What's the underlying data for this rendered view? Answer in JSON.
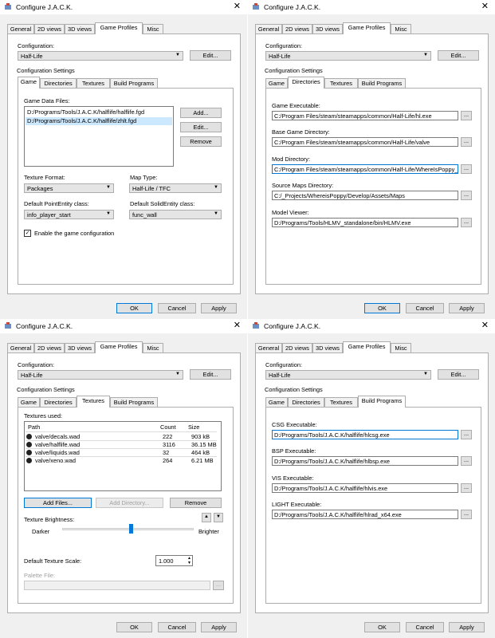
{
  "dialog_title": "Configure J.A.C.K.",
  "close_glyph": "✕",
  "tabs": [
    "General",
    "2D views",
    "3D views",
    "Game Profiles",
    "Misc"
  ],
  "config": {
    "label": "Configuration:",
    "value": "Half-Life",
    "edit": "Edit..."
  },
  "settings_label": "Configuration Settings",
  "subtabs": [
    "Game",
    "Directories",
    "Textures",
    "Build Programs"
  ],
  "footer": {
    "ok": "OK",
    "cancel": "Cancel",
    "apply": "Apply"
  },
  "browse": "...",
  "game": {
    "fgd_label": "Game Data Files:",
    "fgd": [
      "D:/Programs/Tools/J.A.C.K/halflife/halflife.fgd",
      "D:/Programs/Tools/J.A.C.K/halflife/zhlt.fgd"
    ],
    "add": "Add...",
    "edit": "Edit...",
    "remove": "Remove",
    "tex_format_label": "Texture Format:",
    "tex_format": "Packages",
    "map_type_label": "Map Type:",
    "map_type": "Half-Life / TFC",
    "point_label": "Default PointEntity class:",
    "point": "info_player_start",
    "solid_label": "Default SolidEntity class:",
    "solid": "func_wall",
    "enable_label": "Enable the game configuration",
    "check": "✓"
  },
  "dirs": {
    "exe_label": "Game Executable:",
    "exe": "C:/Program Files/steam/steamapps/common/Half-Life/hl.exe",
    "base_label": "Base Game Directory:",
    "base": "C:/Program Files/steam/steamapps/common/Half-Life/valve",
    "mod_label": "Mod Directory:",
    "mod": "C:/Program Files/steam/steamapps/common/Half-Life/WhereIsPoppy_de",
    "src_label": "Source Maps Directory:",
    "src": "C:/_Projects/WhereisPoppy/Develop/Assets/Maps",
    "viewer_label": "Model Viewer:",
    "viewer": "D:/Programs/Tools/HLMV_standalone/bin/HLMV.exe"
  },
  "textures": {
    "used_label": "Textures used:",
    "headers": [
      "Path",
      "Count",
      "Size"
    ],
    "rows": [
      {
        "path": "valve/decals.wad",
        "count": "222",
        "size": "903 kB"
      },
      {
        "path": "valve/halflife.wad",
        "count": "3116",
        "size": "36.15 MB"
      },
      {
        "path": "valve/liquids.wad",
        "count": "32",
        "size": "464 kB"
      },
      {
        "path": "valve/xeno.wad",
        "count": "264",
        "size": "6.21 MB"
      }
    ],
    "add_files": "Add Files...",
    "add_dir": "Add Directory...",
    "remove": "Remove",
    "brightness_label": "Texture Brightness:",
    "darker": "Darker",
    "brighter": "Brighter",
    "brightness_level": 0.52,
    "scale_label": "Default Texture Scale:",
    "scale": "1.000",
    "palette_label": "Palette File:",
    "up": "▲",
    "down": "▼"
  },
  "build": {
    "csg_label": "CSG Executable:",
    "csg": "D:/Programs/Tools/J.A.C.K/halflife/hlcsg.exe",
    "bsp_label": "BSP Executable:",
    "bsp": "D:/Programs/Tools/J.A.C.K/halflife/hlbsp.exe",
    "vis_label": "VIS Executable:",
    "vis": "D:/Programs/Tools/J.A.C.K/halflife/hlvis.exe",
    "light_label": "LIGHT Executable:",
    "light": "D:/Programs/Tools/J.A.C.K/halflife/hlrad_x64.exe"
  }
}
